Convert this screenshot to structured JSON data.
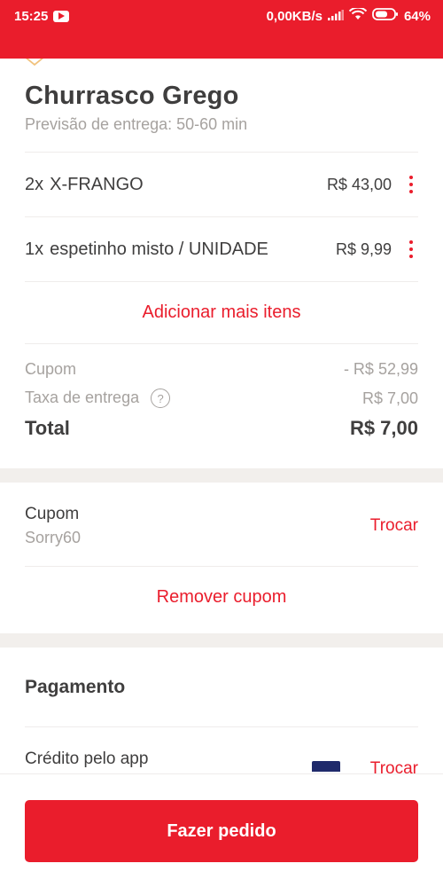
{
  "status_bar": {
    "time": "15:25",
    "network_speed": "0,00KB/s",
    "battery": "64%",
    "icons": [
      "youtube-icon",
      "signal-icon",
      "wifi-icon",
      "battery-icon"
    ]
  },
  "order": {
    "restaurant_name": "Churrasco Grego",
    "delivery_estimate": "Previsão de entrega: 50-60 min",
    "items": [
      {
        "qty": "2x",
        "name": "X-FRANGO",
        "price": "R$ 43,00"
      },
      {
        "qty": "1x",
        "name": "espetinho misto / UNIDADE",
        "price": "R$ 9,99"
      }
    ],
    "add_more_label": "Adicionar mais itens"
  },
  "summary": {
    "coupon_label": "Cupom",
    "coupon_value": "- R$ 52,99",
    "delivery_fee_label": "Taxa de entrega",
    "delivery_fee_help": "?",
    "delivery_fee_value": "R$ 7,00",
    "total_label": "Total",
    "total_value": "R$ 7,00"
  },
  "coupon_section": {
    "title": "Cupom",
    "code": "Sorry60",
    "change_label": "Trocar",
    "remove_label": "Remover cupom"
  },
  "payment": {
    "title": "Pagamento",
    "method": "Crédito pelo app",
    "change_label": "Trocar"
  },
  "footer": {
    "place_order_label": "Fazer pedido"
  },
  "colors": {
    "brand_red": "#ea1d2c",
    "text_dark": "#3f3e3e",
    "text_muted": "#a6a29f",
    "section_gap": "#f2efec"
  }
}
